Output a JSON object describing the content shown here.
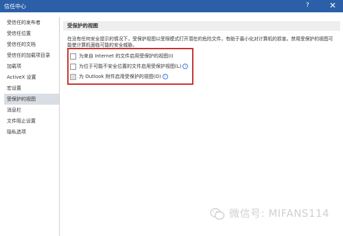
{
  "window": {
    "title": "信任中心",
    "help": "?",
    "close": "✕"
  },
  "sidebar": {
    "items": [
      {
        "label": "受信任的发布者"
      },
      {
        "label": "受信任位置"
      },
      {
        "label": "受信任的文档"
      },
      {
        "label": "受信任的加载项目录"
      },
      {
        "label": "加载项"
      },
      {
        "label": "ActiveX 设置"
      },
      {
        "label": "宏设置"
      },
      {
        "label": "受保护的视图",
        "selected": true
      },
      {
        "label": "消息栏"
      },
      {
        "label": "文件阻止设置"
      },
      {
        "label": "隐私选项"
      }
    ]
  },
  "main": {
    "section_title": "受保护的视图",
    "description": "在没有任何安全提示的情况下，受保护视图以受限模式打开潜在的危险文件，有助于最小化对计算机的损害。禁用受保护的视图可能使计算机面临可能的安全威胁。",
    "options": [
      {
        "label": "为来自 Internet 的文件启用受保护的视图(I)",
        "checked": false,
        "info_icon": false
      },
      {
        "label": "为位于可能不安全位置的文件启用受保护视图(L)",
        "checked": false,
        "info_icon": true
      },
      {
        "label": "为 Outlook 附件启用受保护的视图(O)",
        "checked": false,
        "disabled_look": true,
        "info_icon": true
      }
    ]
  },
  "watermark": {
    "text": "微信号: MIFANS114",
    "icon": "wechat-icon"
  },
  "colors": {
    "titlebar": "#2b5fa8",
    "highlight_box": "#c9302c",
    "selected_item": "#d9dde4",
    "section_header_bg": "#eeeeee"
  }
}
